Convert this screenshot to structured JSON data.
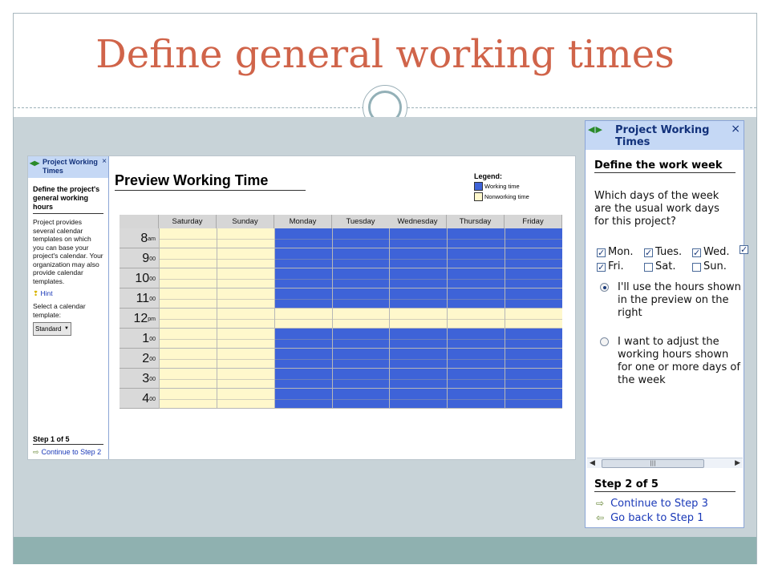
{
  "slide": {
    "title": "Define general working times"
  },
  "preview": {
    "mini_pane": {
      "header": "Project Working Times",
      "close": "×",
      "heading": "Define the project's general working hours",
      "description": "Project provides several calendar templates on which you can base your project's calendar. Your organization may also provide calendar templates.",
      "hint": "Hint",
      "select_label": "Select a calendar template:",
      "select_value": "Standard",
      "step": "Step 1 of 5",
      "next_link": "Continue to Step 2"
    },
    "title": "Preview Working Time",
    "legend": {
      "title": "Legend:",
      "working": "Working time",
      "nonworking": "Nonworking time",
      "working_color": "#3e63d8",
      "nonworking_color": "#fff8cc"
    },
    "grid": {
      "days": [
        "Saturday",
        "Sunday",
        "Monday",
        "Tuesday",
        "Wednesday",
        "Thursday",
        "Friday"
      ],
      "hours": [
        {
          "h": "8",
          "s": "am"
        },
        {
          "h": "9",
          "s": "00"
        },
        {
          "h": "10",
          "s": "00"
        },
        {
          "h": "11",
          "s": "00"
        },
        {
          "h": "12",
          "s": "pm"
        },
        {
          "h": "1",
          "s": "00"
        },
        {
          "h": "2",
          "s": "00"
        },
        {
          "h": "3",
          "s": "00"
        },
        {
          "h": "4",
          "s": "00"
        }
      ],
      "working_days": [
        false,
        false,
        true,
        true,
        true,
        true,
        true
      ],
      "working_hours": [
        true,
        true,
        true,
        true,
        false,
        true,
        true,
        true,
        true
      ]
    }
  },
  "pane": {
    "header": "Project Working Times",
    "close": "×",
    "heading": "Define the work week",
    "question": "Which days of the week are the usual work days for this project?",
    "days": [
      {
        "label": "Mon.",
        "checked": true
      },
      {
        "label": "Tues.",
        "checked": true
      },
      {
        "label": "Wed.",
        "checked": true
      },
      {
        "label": "",
        "checked": true
      },
      {
        "label": "Fri.",
        "checked": true
      },
      {
        "label": "Sat.",
        "checked": false
      },
      {
        "label": "Sun.",
        "checked": false
      }
    ],
    "option_1": "I'll use the hours shown in the preview on the right",
    "option_2": "I want to adjust the working hours shown for one or more days of the week",
    "step": "Step 2 of 5",
    "next_link": "Continue to Step 3",
    "back_link": "Go back to Step 1"
  }
}
